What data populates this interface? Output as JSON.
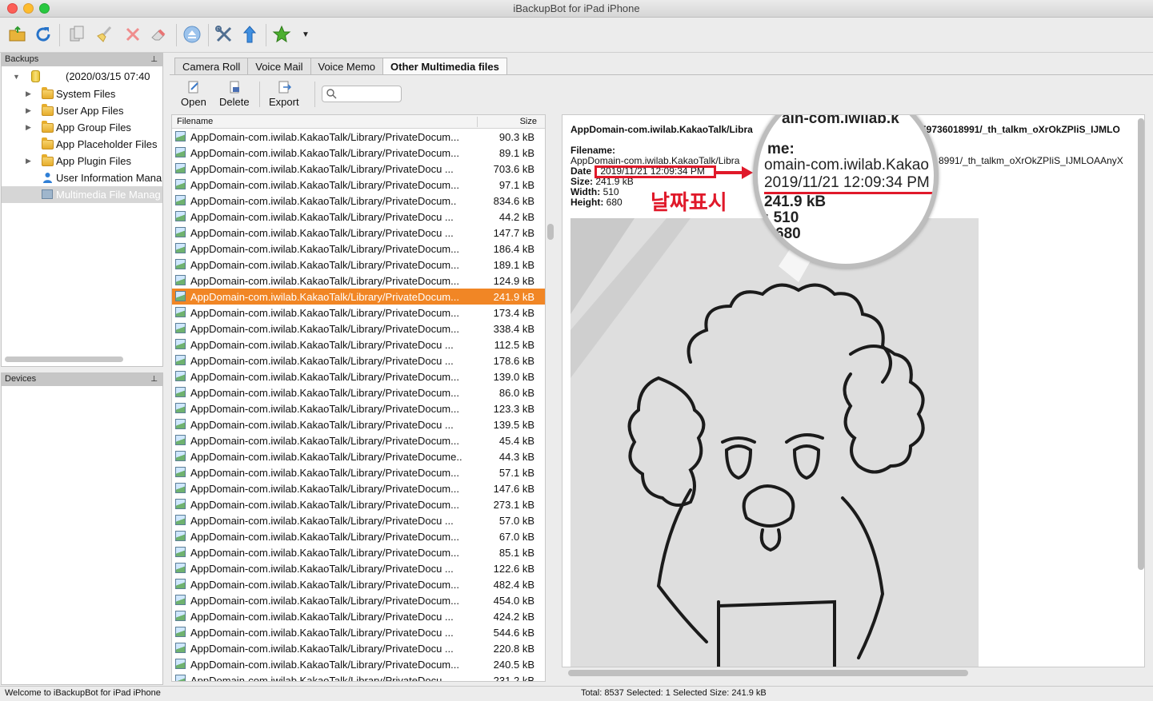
{
  "window": {
    "title": "iBackupBot for iPad iPhone"
  },
  "backups_pane": {
    "header": "Backups",
    "root": "(2020/03/15 07:40",
    "items": [
      {
        "label": "System Files",
        "expandable": true
      },
      {
        "label": "User App Files",
        "expandable": true
      },
      {
        "label": "App Group Files",
        "expandable": true
      },
      {
        "label": "App Placeholder Files",
        "expandable": false
      },
      {
        "label": "App Plugin Files",
        "expandable": true
      },
      {
        "label": "User Information Mana",
        "expandable": false
      },
      {
        "label": "Multimedia File Manag",
        "expandable": false
      }
    ]
  },
  "devices_pane": {
    "header": "Devices"
  },
  "tabs": [
    "Camera Roll",
    "Voice Mail",
    "Voice Memo",
    "Other Multimedia files"
  ],
  "content_toolbar": {
    "open": "Open",
    "delete": "Delete",
    "export": "Export",
    "search_placeholder": ""
  },
  "file_list": {
    "col_filename": "Filename",
    "col_size": "Size",
    "rows": [
      {
        "name": "AppDomain-com.iwilab.KakaoTalk/Library/PrivateDocum...",
        "size": "90.3 kB"
      },
      {
        "name": "AppDomain-com.iwilab.KakaoTalk/Library/PrivateDocum...",
        "size": "89.1 kB"
      },
      {
        "name": "AppDomain-com.iwilab.KakaoTalk/Library/PrivateDocu ...",
        "size": "703.6 kB"
      },
      {
        "name": "AppDomain-com.iwilab.KakaoTalk/Library/PrivateDocum...",
        "size": "97.1 kB"
      },
      {
        "name": "AppDomain-com.iwilab.KakaoTalk/Library/PrivateDocum..",
        "size": "834.6 kB"
      },
      {
        "name": "AppDomain-com.iwilab.KakaoTalk/Library/PrivateDocu ...",
        "size": "44.2 kB"
      },
      {
        "name": "AppDomain-com.iwilab.KakaoTalk/Library/PrivateDocu ...",
        "size": "147.7 kB"
      },
      {
        "name": "AppDomain-com.iwilab.KakaoTalk/Library/PrivateDocum...",
        "size": "186.4 kB"
      },
      {
        "name": "AppDomain-com.iwilab.KakaoTalk/Library/PrivateDocum...",
        "size": "189.1 kB"
      },
      {
        "name": "AppDomain-com.iwilab.KakaoTalk/Library/PrivateDocum...",
        "size": "124.9 kB"
      },
      {
        "name": "AppDomain-com.iwilab.KakaoTalk/Library/PrivateDocum...",
        "size": "241.9 kB",
        "selected": true
      },
      {
        "name": "AppDomain-com.iwilab.KakaoTalk/Library/PrivateDocum...",
        "size": "173.4 kB"
      },
      {
        "name": "AppDomain-com.iwilab.KakaoTalk/Library/PrivateDocum...",
        "size": "338.4 kB"
      },
      {
        "name": "AppDomain-com.iwilab.KakaoTalk/Library/PrivateDocu ...",
        "size": "112.5 kB"
      },
      {
        "name": "AppDomain-com.iwilab.KakaoTalk/Library/PrivateDocu ...",
        "size": "178.6 kB"
      },
      {
        "name": "AppDomain-com.iwilab.KakaoTalk/Library/PrivateDocum...",
        "size": "139.0 kB"
      },
      {
        "name": "AppDomain-com.iwilab.KakaoTalk/Library/PrivateDocum...",
        "size": "86.0 kB"
      },
      {
        "name": "AppDomain-com.iwilab.KakaoTalk/Library/PrivateDocum...",
        "size": "123.3 kB"
      },
      {
        "name": "AppDomain-com.iwilab.KakaoTalk/Library/PrivateDocu ...",
        "size": "139.5 kB"
      },
      {
        "name": "AppDomain-com.iwilab.KakaoTalk/Library/PrivateDocum...",
        "size": "45.4 kB"
      },
      {
        "name": "AppDomain-com.iwilab.KakaoTalk/Library/PrivateDocume..",
        "size": "44.3 kB"
      },
      {
        "name": "AppDomain-com.iwilab.KakaoTalk/Library/PrivateDocum...",
        "size": "57.1 kB"
      },
      {
        "name": "AppDomain-com.iwilab.KakaoTalk/Library/PrivateDocum...",
        "size": "147.6 kB"
      },
      {
        "name": "AppDomain-com.iwilab.KakaoTalk/Library/PrivateDocum...",
        "size": "273.1 kB"
      },
      {
        "name": "AppDomain-com.iwilab.KakaoTalk/Library/PrivateDocu ...",
        "size": "57.0 kB"
      },
      {
        "name": "AppDomain-com.iwilab.KakaoTalk/Library/PrivateDocum...",
        "size": "67.0 kB"
      },
      {
        "name": "AppDomain-com.iwilab.KakaoTalk/Library/PrivateDocum...",
        "size": "85.1 kB"
      },
      {
        "name": "AppDomain-com.iwilab.KakaoTalk/Library/PrivateDocu ...",
        "size": "122.6 kB"
      },
      {
        "name": "AppDomain-com.iwilab.KakaoTalk/Library/PrivateDocum...",
        "size": "482.4 kB"
      },
      {
        "name": "AppDomain-com.iwilab.KakaoTalk/Library/PrivateDocum...",
        "size": "454.0 kB"
      },
      {
        "name": "AppDomain-com.iwilab.KakaoTalk/Library/PrivateDocu ...",
        "size": "424.2 kB"
      },
      {
        "name": "AppDomain-com.iwilab.KakaoTalk/Library/PrivateDocu ...",
        "size": "544.6 kB"
      },
      {
        "name": "AppDomain-com.iwilab.KakaoTalk/Library/PrivateDocu ...",
        "size": "220.8 kB"
      },
      {
        "name": "AppDomain-com.iwilab.KakaoTalk/Library/PrivateDocum...",
        "size": "240.5 kB"
      },
      {
        "name": "AppDomain-com.iwilab.KakaoTalk/Library/PrivateDocu",
        "size": "231.2 kB"
      }
    ]
  },
  "detail": {
    "title_left": "AppDomain-com.iwilab.KakaoTalk/Libra",
    "title_right": "59736018991/_th_talkm_oXrOkZPIiS_IJMLO",
    "filename_label": "Filename:",
    "filename_value_left": "AppDomain-com.iwilab.KakaoTalk/Libra",
    "filename_value_right": "8991/_th_talkm_oXrOkZPIiS_IJMLOAAnyX",
    "date_label": "Date",
    "date_value": "2019/11/21 12:09:34 PM",
    "size_label": "Size:",
    "size_value": "241.9 kB",
    "width_label": "Width:",
    "width_value": "510",
    "height_label": "Height:",
    "height_value": "680",
    "annotation": "날짜표시",
    "magnifier": {
      "line1": "ain-com.iwilab.k",
      "line2": "me:",
      "line3": "omain-com.iwilab.Kakao",
      "line4": "2019/11/21 12:09:34 PM",
      "line5": "241.9 kB",
      "line6": ": 510",
      "line7": "680"
    }
  },
  "status": {
    "left": "Welcome to iBackupBot for iPad iPhone",
    "right": "Total: 8537 Selected: 1 Selected Size: 241.9 kB"
  },
  "colors": {
    "selection": "#f18625",
    "annotation": "#e0192a"
  }
}
